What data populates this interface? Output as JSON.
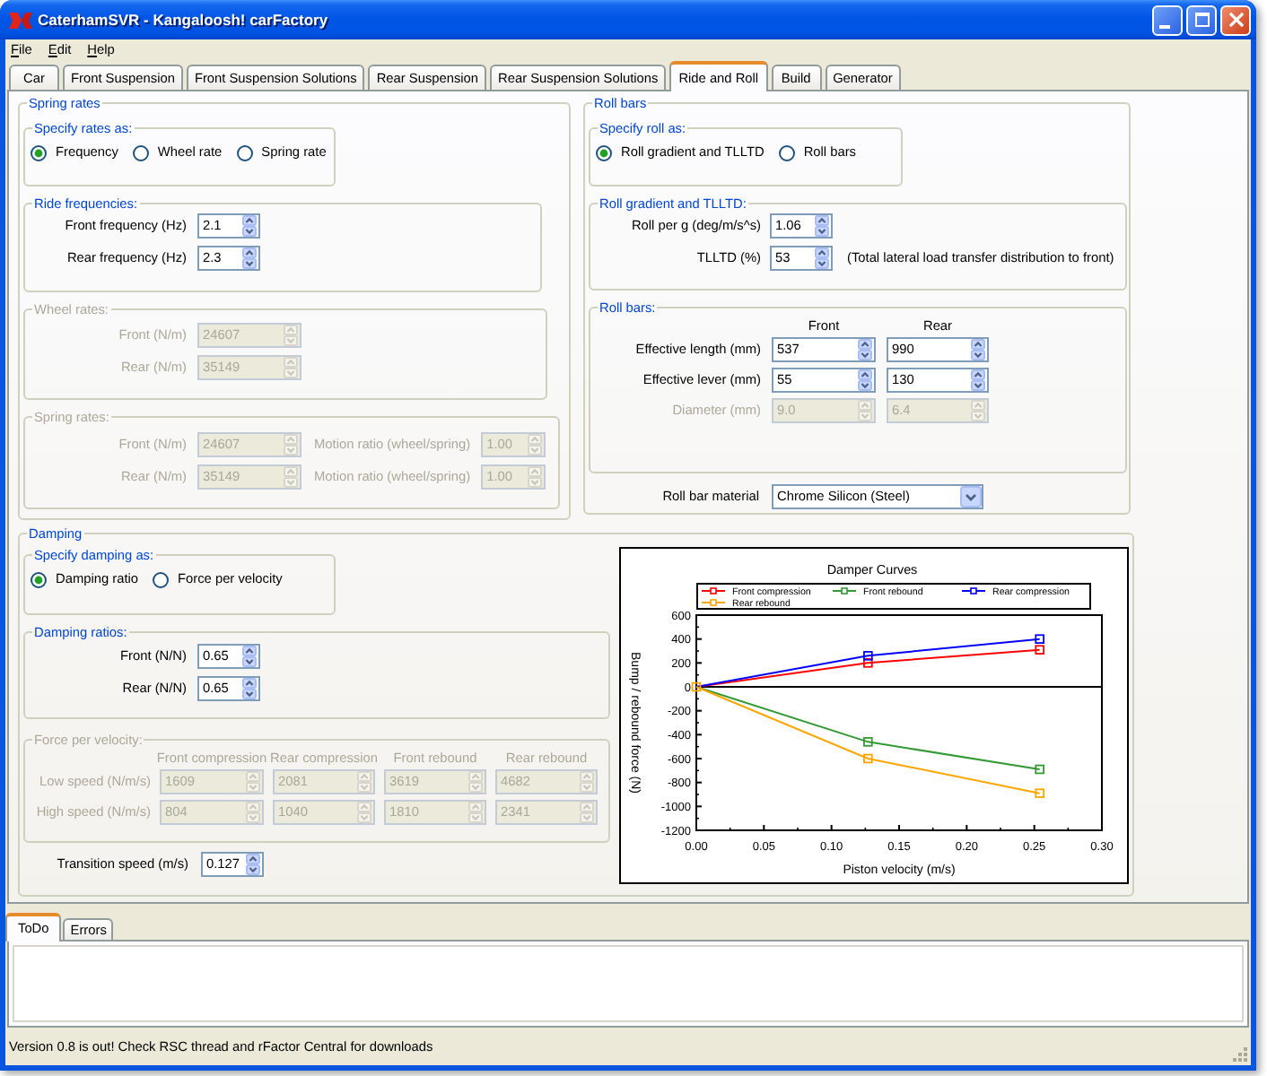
{
  "window": {
    "title": "CaterhamSVR - Kangaloosh! carFactory"
  },
  "menu": [
    "File",
    "Edit",
    "Help"
  ],
  "tabs": [
    {
      "label": "Car",
      "selected": false
    },
    {
      "label": "Front Suspension",
      "selected": false
    },
    {
      "label": "Front Suspension Solutions",
      "selected": false
    },
    {
      "label": "Rear Suspension",
      "selected": false
    },
    {
      "label": "Rear Suspension Solutions",
      "selected": false
    },
    {
      "label": "Ride and Roll",
      "selected": true
    },
    {
      "label": "Build",
      "selected": false
    },
    {
      "label": "Generator",
      "selected": false
    }
  ],
  "spring_rates": {
    "title": "Spring rates",
    "specify": {
      "title": "Specify rates as:",
      "options": [
        {
          "label": "Frequency",
          "selected": true
        },
        {
          "label": "Wheel rate",
          "selected": false
        },
        {
          "label": "Spring rate",
          "selected": false
        }
      ]
    },
    "ride_frequencies": {
      "title": "Ride frequencies:",
      "disabled": false,
      "fields": [
        {
          "label": "Front frequency (Hz)",
          "value": "2.1",
          "disabled": false
        },
        {
          "label": "Rear frequency (Hz)",
          "value": "2.3",
          "disabled": false
        }
      ]
    },
    "wheel_rates": {
      "title": "Wheel rates:",
      "disabled": true,
      "fields": [
        {
          "label": "Front (N/m)",
          "value": "24607",
          "disabled": true
        },
        {
          "label": "Rear (N/m)",
          "value": "35149",
          "disabled": true
        }
      ]
    },
    "spring_rates_group": {
      "title": "Spring rates:",
      "disabled": true,
      "rows": [
        {
          "label": "Front (N/m)",
          "value": "24607",
          "ratio_label": "Motion ratio (wheel/spring)",
          "ratio_value": "1.00",
          "disabled": true
        },
        {
          "label": "Rear (N/m)",
          "value": "35149",
          "ratio_label": "Motion ratio (wheel/spring)",
          "ratio_value": "1.00",
          "disabled": true
        }
      ]
    }
  },
  "roll_bars": {
    "title": "Roll bars",
    "specify": {
      "title": "Specify roll as:",
      "options": [
        {
          "label": "Roll gradient and TLLTD",
          "selected": true
        },
        {
          "label": "Roll bars",
          "selected": false
        }
      ]
    },
    "roll_gradient": {
      "title": "Roll gradient and TLLTD:",
      "disabled": false,
      "fields": [
        {
          "label": "Roll per g (deg/m/s^s)",
          "value": "1.06",
          "disabled": false
        },
        {
          "label": "TLLTD (%)",
          "value": "53",
          "disabled": false,
          "note": "(Total lateral load transfer distribution to front)"
        }
      ]
    },
    "bars": {
      "title": "Roll bars:",
      "disabled": false,
      "columns": [
        "Front",
        "Rear"
      ],
      "rows": [
        {
          "label": "Effective length (mm)",
          "values": [
            "537",
            "990"
          ],
          "disabled": false
        },
        {
          "label": "Effective lever (mm)",
          "values": [
            "55",
            "130"
          ],
          "disabled": false
        },
        {
          "label": "Diameter (mm)",
          "values": [
            "9.0",
            "6.4"
          ],
          "disabled": true
        }
      ]
    },
    "material": {
      "label": "Roll bar material",
      "value": "Chrome Silicon (Steel)"
    }
  },
  "damping": {
    "title": "Damping",
    "specify": {
      "title": "Specify damping as:",
      "options": [
        {
          "label": "Damping ratio",
          "selected": true
        },
        {
          "label": "Force per velocity",
          "selected": false
        }
      ]
    },
    "damping_ratios": {
      "title": "Damping ratios:",
      "disabled": false,
      "fields": [
        {
          "label": "Front (N/N)",
          "value": "0.65",
          "disabled": false
        },
        {
          "label": "Rear (N/N)",
          "value": "0.65",
          "disabled": false
        }
      ]
    },
    "force_per_velocity": {
      "title": "Force per velocity:",
      "disabled": true,
      "columns": [
        "Front compression",
        "Rear compression",
        "Front rebound",
        "Rear rebound"
      ],
      "rows": [
        {
          "label": "Low speed (N/m/s)",
          "values": [
            "1609",
            "2081",
            "3619",
            "4682"
          ],
          "disabled": true
        },
        {
          "label": "High speed (N/m/s)",
          "values": [
            "804",
            "1040",
            "1810",
            "2341"
          ],
          "disabled": true
        }
      ]
    },
    "transition": {
      "label": "Transition speed (m/s)",
      "value": "0.127",
      "disabled": false
    },
    "chart_data": {
      "type": "line",
      "title": "Damper Curves",
      "legend": "top",
      "xlabel": "Piston velocity (m/s)",
      "ylabel": "Bump / rebound force (N)",
      "x": [
        0,
        0.127,
        0.254
      ],
      "series": [
        {
          "name": "Front compression",
          "color": "#ff0000",
          "marker": "square",
          "values": [
            0,
            200,
            310
          ]
        },
        {
          "name": "Front rebound",
          "color": "#339933",
          "marker": "square",
          "values": [
            0,
            -460,
            -690
          ]
        },
        {
          "name": "Rear compression",
          "color": "#0000ff",
          "marker": "square",
          "values": [
            0,
            260,
            400
          ]
        },
        {
          "name": "Rear rebound",
          "color": "#ffa500",
          "marker": "square",
          "values": [
            0,
            -600,
            -890
          ]
        }
      ],
      "xlim": [
        0,
        0.3
      ],
      "ylim": [
        -1200,
        600
      ],
      "xticks": [
        {
          "value": 0,
          "label": "0.00"
        },
        {
          "value": 0.05,
          "label": "0.05"
        },
        {
          "value": 0.1,
          "label": "0.10"
        },
        {
          "value": 0.15,
          "label": "0.15"
        },
        {
          "value": 0.2,
          "label": "0.20"
        },
        {
          "value": 0.25,
          "label": "0.25"
        },
        {
          "value": 0.3,
          "label": "0.30"
        }
      ],
      "yticks": [
        600,
        400,
        200,
        0,
        -200,
        -400,
        -600,
        -800,
        -1000,
        -1200
      ]
    }
  },
  "bottom_tabs": [
    {
      "label": "ToDo",
      "selected": true
    },
    {
      "label": "Errors",
      "selected": false
    }
  ],
  "status_bar": {
    "text": "Version 0.8 is out! Check RSC thread and rFactor Central for downloads"
  }
}
